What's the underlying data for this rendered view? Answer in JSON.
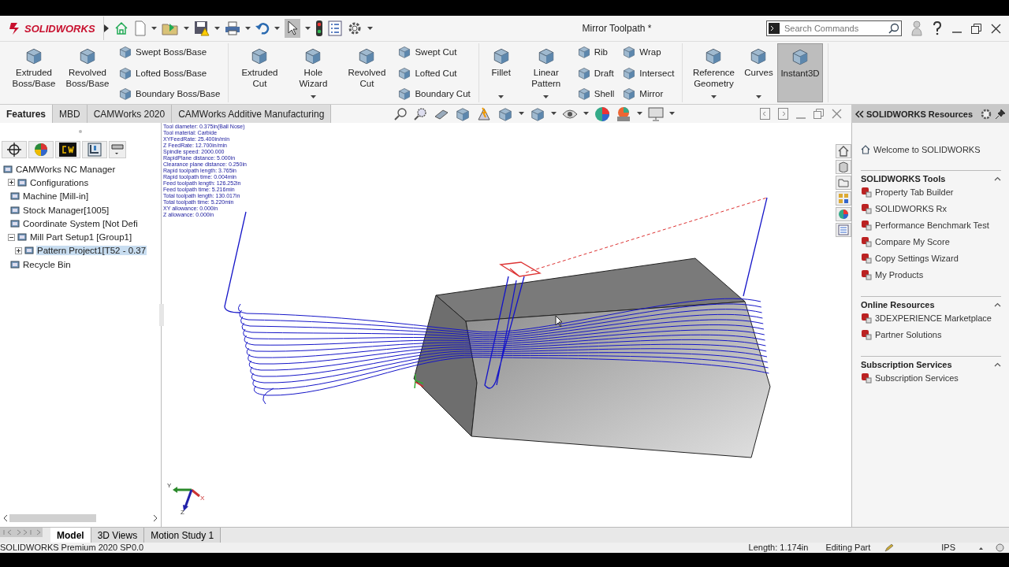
{
  "app": {
    "logo": "SOLIDWORKS",
    "title": "Mirror Toolpath *",
    "search": {
      "placeholder": "Search Commands"
    }
  },
  "ribbon": {
    "groups": [
      {
        "items": [
          {
            "kind": "large",
            "label": "Extruded Boss/Base",
            "dropdown": false,
            "on": false
          },
          {
            "kind": "large",
            "label": "Revolved Boss/Base",
            "dropdown": false,
            "on": false
          },
          {
            "kind": "column",
            "items": [
              "Swept Boss/Base",
              "Lofted Boss/Base",
              "Boundary Boss/Base"
            ]
          }
        ]
      },
      {
        "items": [
          {
            "kind": "large",
            "label": "Extruded Cut",
            "dropdown": false,
            "on": false
          },
          {
            "kind": "large",
            "label": "Hole Wizard",
            "dropdown": true,
            "on": false
          },
          {
            "kind": "large",
            "label": "Revolved Cut",
            "dropdown": false,
            "on": false
          },
          {
            "kind": "column",
            "items": [
              "Swept Cut",
              "Lofted Cut",
              "Boundary Cut"
            ]
          }
        ]
      },
      {
        "items": [
          {
            "kind": "large",
            "label": "Fillet",
            "dropdown": true,
            "on": false
          },
          {
            "kind": "large",
            "label": "Linear Pattern",
            "dropdown": true,
            "on": false
          },
          {
            "kind": "column",
            "items": [
              "Rib",
              "Draft",
              "Shell"
            ]
          },
          {
            "kind": "column",
            "items": [
              "Wrap",
              "Intersect",
              "Mirror"
            ]
          }
        ]
      },
      {
        "items": [
          {
            "kind": "large",
            "label": "Reference Geometry",
            "dropdown": true,
            "on": false
          },
          {
            "kind": "large",
            "label": "Curves",
            "dropdown": true,
            "on": false
          },
          {
            "kind": "large",
            "label": "Instant3D",
            "dropdown": false,
            "on": true
          }
        ]
      }
    ]
  },
  "tabs": [
    {
      "label": "Features",
      "selected": true
    },
    {
      "label": "MBD",
      "selected": false
    },
    {
      "label": "CAMWorks 2020",
      "selected": false
    },
    {
      "label": "CAMWorks Additive Manufacturing",
      "selected": false
    }
  ],
  "tree": [
    {
      "label": "CAMWorks NC Manager",
      "selected": false,
      "children": [
        {
          "label": "Configurations",
          "selected": false,
          "expanded": false
        },
        {
          "label": "Machine [Mill-in]",
          "selected": false
        },
        {
          "label": "Stock Manager[1005]",
          "selected": false
        },
        {
          "label": "Coordinate System [Not Defi",
          "selected": false
        },
        {
          "label": "Mill Part Setup1 [Group1]",
          "selected": false,
          "expanded": true,
          "children": [
            {
              "label": "Pattern Project1[T52 - 0.37",
              "selected": true,
              "expanded": false
            }
          ]
        },
        {
          "label": "Recycle Bin",
          "selected": false
        }
      ]
    }
  ],
  "viewport": {
    "info_lines": [
      "Tool diameter: 0.375in(Ball Nose)",
      "Tool material: Carbide",
      "XYFeedRate: 25.400in/min",
      "Z FeedRate: 12.700in/min",
      "Spindle speed: 2000.000",
      "RapidPlane distance: 5.000in",
      "Clearance plane distance: 0.250in",
      "Rapid toolpath length: 3.765in",
      "Rapid toolpath time: 0.004min",
      "Feed toolpath length: 126.252in",
      "Feed toolpath time: 5.216min",
      "Total toolpath length: 130.017in",
      "Total toolpath time: 5.220min",
      "XY allowance: 0.000in",
      "Z allowance: 0.000in"
    ],
    "triad_labels": [
      "Y",
      "X",
      "Z"
    ]
  },
  "resources": {
    "title": "SOLIDWORKS Resources",
    "welcome": "Welcome to SOLIDWORKS",
    "sections": [
      {
        "title": "SOLIDWORKS Tools",
        "expanded": true,
        "items": [
          "Property Tab Builder",
          "SOLIDWORKS Rx",
          "Performance Benchmark Test",
          "Compare My Score",
          "Copy Settings Wizard",
          "My Products"
        ]
      },
      {
        "title": "Online Resources",
        "expanded": true,
        "items": [
          "3DEXPERIENCE Marketplace",
          "Partner Solutions"
        ]
      },
      {
        "title": "Subscription Services",
        "expanded": true,
        "items": [
          "Subscription Services"
        ]
      }
    ]
  },
  "bottom_tabs": [
    {
      "label": "Model",
      "selected": true
    },
    {
      "label": "3D Views",
      "selected": false
    },
    {
      "label": "Motion Study 1",
      "selected": false
    }
  ],
  "status_bar": {
    "product": "SOLIDWORKS Premium 2020 SP0.0",
    "length": "Length: 1.174in",
    "mode": "Editing Part",
    "units": "IPS"
  }
}
